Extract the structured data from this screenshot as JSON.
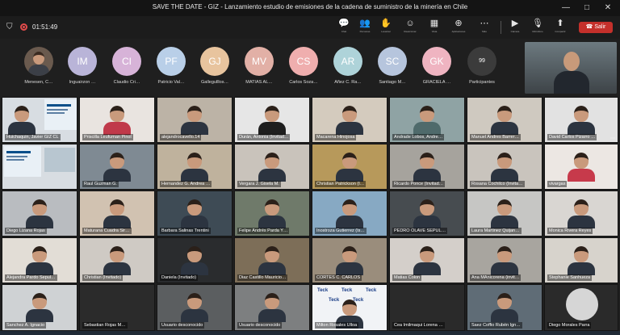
{
  "window": {
    "title": "SAVE THE DATE - GIZ - Lanzamiento estudio de emisiones de la cadena de suministro de la minería en Chile",
    "controls": [
      "—",
      "□",
      "✕"
    ]
  },
  "toolbar": {
    "timer": "01:51:49",
    "controls": [
      {
        "icon": "chat-icon",
        "glyph": "💬",
        "label": "Chat"
      },
      {
        "icon": "people-icon",
        "glyph": "👥",
        "label": "Personas"
      },
      {
        "icon": "hand-icon",
        "glyph": "✋",
        "label": "Levantar"
      },
      {
        "icon": "react-icon",
        "glyph": "☺",
        "label": "Reaccionar"
      },
      {
        "icon": "view-icon",
        "glyph": "▦",
        "label": "Vista"
      },
      {
        "icon": "apps-icon",
        "glyph": "⊕",
        "label": "Aplicaciones"
      },
      {
        "icon": "more-icon",
        "glyph": "⋯",
        "label": "Más"
      },
      {
        "icon": "camera-icon",
        "glyph": "▶",
        "label": "Cámara"
      },
      {
        "icon": "mic-muted-icon",
        "glyph": "🎙",
        "label": "Micrófono"
      },
      {
        "icon": "share-icon",
        "glyph": "⬆",
        "label": "Compartir"
      }
    ],
    "leave_label": "Salir"
  },
  "strip": {
    "participants": [
      {
        "initials": "",
        "name": "Menesen, C…",
        "color": "#6a5a4e",
        "photo": true
      },
      {
        "initials": "IM",
        "name": "Inguairzon …",
        "color": "#b9b4d8"
      },
      {
        "initials": "CI",
        "name": "Claudio Cri…",
        "color": "#d7b3d8"
      },
      {
        "initials": "PF",
        "name": "Patricio Val…",
        "color": "#b9cfe8"
      },
      {
        "initials": "GJ",
        "name": "Gallegulllos…",
        "color": "#e8c49e"
      },
      {
        "initials": "MV",
        "name": "MATÍAS AL…",
        "color": "#e2b0a6"
      },
      {
        "initials": "CS",
        "name": "Carlos Soza…",
        "color": "#efaeae"
      },
      {
        "initials": "AR",
        "name": "Añez C. Ra…",
        "color": "#aed3d9"
      },
      {
        "initials": "SC",
        "name": "Santiago M…",
        "color": "#b6c5dd"
      },
      {
        "initials": "GK",
        "name": "GRACIELA …",
        "color": "#efb4c1"
      },
      {
        "initials": "99",
        "name": "Participantes",
        "color": "#3b3b3b"
      }
    ]
  },
  "grid": {
    "tiles": [
      [
        "Huichaquin, Javier GIZ CL",
        "Priscilla Leufuman Pinol",
        "alejandrocavello.14",
        "Durán, Antonia (Invitad…",
        "Macarena Hinojosa",
        "Andrade Lobos, Andre…",
        "Manuel Andres Barrer…",
        "David Carlos Pizarro …"
      ],
      [
        "Raul Guzman G.",
        "Hernandez G. Andrea …",
        "Vergara J. Gisela M.",
        "Christian Patrickson (I…",
        "Ricardo Ponce (Invitad…",
        "Rosana Cochilco (Invita…",
        "vivargas"
      ],
      [
        "Diego Lizana Rojas",
        "Maturana Cuadra Sir…",
        "Barbara Salinas Trentini",
        "Felipe Andrés Parda Y…",
        "Inostroza Gutierrez (Is…",
        "PEDRO OLAVE SEPUL…",
        "Laura Martinez Quijan…",
        "Monica Rivera Reyes"
      ],
      [
        "Alejandra Pardo Sepul…",
        "Christian (Invitado)",
        "Daniela (Invitado)",
        "Diaz Castillo Mauricio…",
        "CORTES C. CARLOS",
        "Matias Colon",
        "Ana MAnicorena (invit…",
        "Stephanie Sanhueza"
      ],
      [
        "Sanchez A. Ignacio",
        "Sebastian Rojas M…",
        "Usuario desconocido",
        "Usuario desconocido",
        "Milton Rosales Ulloa",
        "Cea Imilmaqui Lorena …",
        "Saez Coffio Rubén Ign…",
        "Diego Morales Parra"
      ]
    ],
    "teck_brand": "Teck"
  }
}
